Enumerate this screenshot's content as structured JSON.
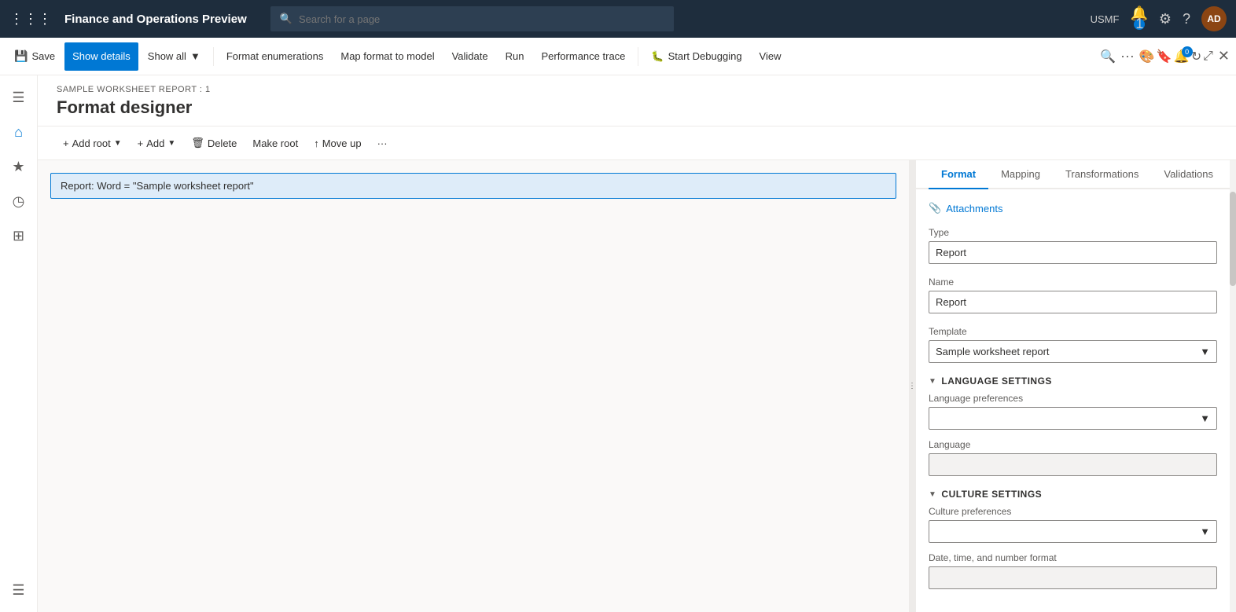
{
  "topNav": {
    "gridIcon": "⋮⋮⋮",
    "appTitle": "Finance and Operations Preview",
    "searchPlaceholder": "Search for a page",
    "usmf": "USMF",
    "notifCount": "1",
    "badgeCount": "0",
    "userInitials": "AD"
  },
  "commandBar": {
    "saveLabel": "Save",
    "showDetailsLabel": "Show details",
    "showAllLabel": "Show all",
    "formatEnumerationsLabel": "Format enumerations",
    "mapFormatToModelLabel": "Map format to model",
    "validateLabel": "Validate",
    "runLabel": "Run",
    "performanceTraceLabel": "Performance trace",
    "startDebuggingLabel": "Start Debugging",
    "viewLabel": "View"
  },
  "toolbar": {
    "addRootLabel": "Add root",
    "addLabel": "Add",
    "deleteLabel": "Delete",
    "makeRootLabel": "Make root",
    "moveUpLabel": "Move up",
    "moreLabel": "···"
  },
  "breadcrumb": "SAMPLE WORKSHEET REPORT : 1",
  "pageTitle": "Format designer",
  "treeItem": {
    "label": "Report: Word = \"Sample worksheet report\""
  },
  "properties": {
    "tabs": [
      {
        "id": "format",
        "label": "Format",
        "active": true
      },
      {
        "id": "mapping",
        "label": "Mapping",
        "active": false
      },
      {
        "id": "transformations",
        "label": "Transformations",
        "active": false
      },
      {
        "id": "validations",
        "label": "Validations",
        "active": false
      }
    ],
    "attachmentsLabel": "Attachments",
    "typeLabel": "Type",
    "typeValue": "Report",
    "nameLabel": "Name",
    "nameValue": "Report",
    "templateLabel": "Template",
    "templateValue": "Sample worksheet report",
    "languageSettingsHeader": "LANGUAGE SETTINGS",
    "languagePreferencesLabel": "Language preferences",
    "languagePreferencesValue": "",
    "languageLabel": "Language",
    "languageValue": "",
    "cultureSettingsHeader": "CULTURE SETTINGS",
    "culturePreferencesLabel": "Culture preferences",
    "culturePreferencesValue": "",
    "dateTimeFormatLabel": "Date, time, and number format",
    "dateTimeFormatValue": ""
  },
  "sidebar": {
    "items": [
      {
        "icon": "☰",
        "name": "menu"
      },
      {
        "icon": "⌂",
        "name": "home"
      },
      {
        "icon": "★",
        "name": "favorites"
      },
      {
        "icon": "◷",
        "name": "recent"
      },
      {
        "icon": "⊞",
        "name": "workspaces"
      },
      {
        "icon": "☰",
        "name": "modules"
      }
    ]
  }
}
